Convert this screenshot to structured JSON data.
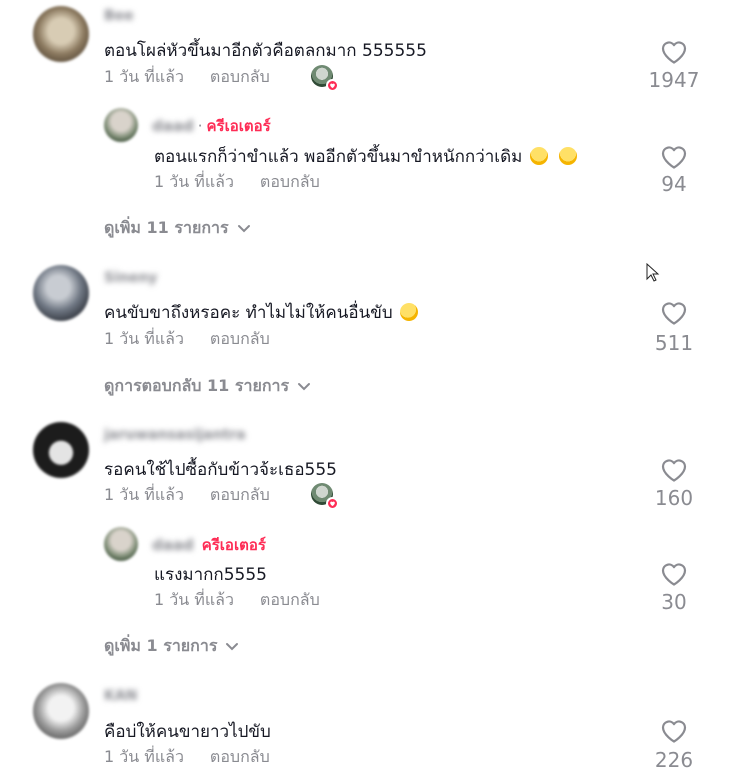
{
  "comments": [
    {
      "username": "Bee",
      "text": "ตอนโผล่หัวขึ้นมาอีกตัวคือตลกมาก 555555",
      "time": "1 วัน ที่แล้ว",
      "reply_label": "ตอบกลับ",
      "likes": "1947",
      "creator_liked": true,
      "avatar_colors": [
        "#c2b59e",
        "#6b5c48"
      ],
      "replies": [
        {
          "username": "daad",
          "creator_label": "ครีเอเตอร์",
          "text": "ตอนแรกก็ว่าขำแล้ว พออีกตัวขึ้นมาขำหนักกว่าเดิม",
          "emojis": [
            "face-with-tears-of-joy",
            "face-with-tears-of-joy"
          ],
          "time": "1 วัน ที่แล้ว",
          "reply_label": "ตอบกลับ",
          "likes": "94"
        }
      ],
      "more_label": "ดูเพิ่ม 11 รายการ"
    },
    {
      "username": "Sineny",
      "text": "คนขับขาถึงหรอคะ ทำไมไม่ให้คนอื่นขับ",
      "emojis": [
        "rolling-on-the-floor-laughing"
      ],
      "time": "1 วัน ที่แล้ว",
      "reply_label": "ตอบกลับ",
      "likes": "511",
      "creator_liked": false,
      "avatar_colors": [
        "#9aa0a8",
        "#3a3d45"
      ],
      "more_label": "ดูการตอบกลับ 11 รายการ"
    },
    {
      "username": "jaruwansasijantra",
      "text": "รอคนใช้ไปซื้อกับข้าวจ้ะเธอ555",
      "time": "1 วัน ที่แล้ว",
      "reply_label": "ตอบกลับ",
      "likes": "160",
      "creator_liked": true,
      "avatar_colors": [
        "#d9d9d9",
        "#1e1e1e"
      ],
      "replies": [
        {
          "username": "daad",
          "creator_label": "ครีเอเตอร์",
          "text": "แรงมากก5555",
          "time": "1 วัน ที่แล้ว",
          "reply_label": "ตอบกลับ",
          "likes": "30"
        }
      ],
      "more_label": "ดูเพิ่ม 1 รายการ"
    },
    {
      "username": "KAN",
      "text": "คือบ่ให้คนขายาวไปขับ",
      "time": "1 วัน ที่แล้ว",
      "reply_label": "ตอบกลับ",
      "likes": "226",
      "creator_liked": false,
      "avatar_colors": [
        "#e6e6e6",
        "#707070"
      ]
    }
  ],
  "colors": {
    "text": "#161823",
    "secondary": "#8a8b91",
    "creator": "#fe2c55"
  }
}
